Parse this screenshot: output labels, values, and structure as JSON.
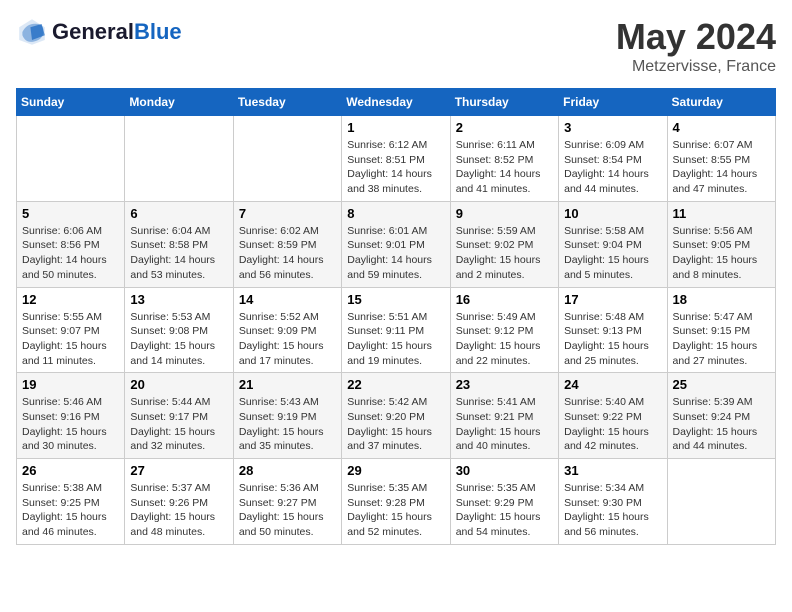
{
  "header": {
    "logo_line1": "General",
    "logo_line2": "Blue",
    "month_title": "May 2024",
    "location": "Metzervisse, France"
  },
  "days_of_week": [
    "Sunday",
    "Monday",
    "Tuesday",
    "Wednesday",
    "Thursday",
    "Friday",
    "Saturday"
  ],
  "weeks": [
    [
      {
        "day": "",
        "info": ""
      },
      {
        "day": "",
        "info": ""
      },
      {
        "day": "",
        "info": ""
      },
      {
        "day": "1",
        "info": "Sunrise: 6:12 AM\nSunset: 8:51 PM\nDaylight: 14 hours and 38 minutes."
      },
      {
        "day": "2",
        "info": "Sunrise: 6:11 AM\nSunset: 8:52 PM\nDaylight: 14 hours and 41 minutes."
      },
      {
        "day": "3",
        "info": "Sunrise: 6:09 AM\nSunset: 8:54 PM\nDaylight: 14 hours and 44 minutes."
      },
      {
        "day": "4",
        "info": "Sunrise: 6:07 AM\nSunset: 8:55 PM\nDaylight: 14 hours and 47 minutes."
      }
    ],
    [
      {
        "day": "5",
        "info": "Sunrise: 6:06 AM\nSunset: 8:56 PM\nDaylight: 14 hours and 50 minutes."
      },
      {
        "day": "6",
        "info": "Sunrise: 6:04 AM\nSunset: 8:58 PM\nDaylight: 14 hours and 53 minutes."
      },
      {
        "day": "7",
        "info": "Sunrise: 6:02 AM\nSunset: 8:59 PM\nDaylight: 14 hours and 56 minutes."
      },
      {
        "day": "8",
        "info": "Sunrise: 6:01 AM\nSunset: 9:01 PM\nDaylight: 14 hours and 59 minutes."
      },
      {
        "day": "9",
        "info": "Sunrise: 5:59 AM\nSunset: 9:02 PM\nDaylight: 15 hours and 2 minutes."
      },
      {
        "day": "10",
        "info": "Sunrise: 5:58 AM\nSunset: 9:04 PM\nDaylight: 15 hours and 5 minutes."
      },
      {
        "day": "11",
        "info": "Sunrise: 5:56 AM\nSunset: 9:05 PM\nDaylight: 15 hours and 8 minutes."
      }
    ],
    [
      {
        "day": "12",
        "info": "Sunrise: 5:55 AM\nSunset: 9:07 PM\nDaylight: 15 hours and 11 minutes."
      },
      {
        "day": "13",
        "info": "Sunrise: 5:53 AM\nSunset: 9:08 PM\nDaylight: 15 hours and 14 minutes."
      },
      {
        "day": "14",
        "info": "Sunrise: 5:52 AM\nSunset: 9:09 PM\nDaylight: 15 hours and 17 minutes."
      },
      {
        "day": "15",
        "info": "Sunrise: 5:51 AM\nSunset: 9:11 PM\nDaylight: 15 hours and 19 minutes."
      },
      {
        "day": "16",
        "info": "Sunrise: 5:49 AM\nSunset: 9:12 PM\nDaylight: 15 hours and 22 minutes."
      },
      {
        "day": "17",
        "info": "Sunrise: 5:48 AM\nSunset: 9:13 PM\nDaylight: 15 hours and 25 minutes."
      },
      {
        "day": "18",
        "info": "Sunrise: 5:47 AM\nSunset: 9:15 PM\nDaylight: 15 hours and 27 minutes."
      }
    ],
    [
      {
        "day": "19",
        "info": "Sunrise: 5:46 AM\nSunset: 9:16 PM\nDaylight: 15 hours and 30 minutes."
      },
      {
        "day": "20",
        "info": "Sunrise: 5:44 AM\nSunset: 9:17 PM\nDaylight: 15 hours and 32 minutes."
      },
      {
        "day": "21",
        "info": "Sunrise: 5:43 AM\nSunset: 9:19 PM\nDaylight: 15 hours and 35 minutes."
      },
      {
        "day": "22",
        "info": "Sunrise: 5:42 AM\nSunset: 9:20 PM\nDaylight: 15 hours and 37 minutes."
      },
      {
        "day": "23",
        "info": "Sunrise: 5:41 AM\nSunset: 9:21 PM\nDaylight: 15 hours and 40 minutes."
      },
      {
        "day": "24",
        "info": "Sunrise: 5:40 AM\nSunset: 9:22 PM\nDaylight: 15 hours and 42 minutes."
      },
      {
        "day": "25",
        "info": "Sunrise: 5:39 AM\nSunset: 9:24 PM\nDaylight: 15 hours and 44 minutes."
      }
    ],
    [
      {
        "day": "26",
        "info": "Sunrise: 5:38 AM\nSunset: 9:25 PM\nDaylight: 15 hours and 46 minutes."
      },
      {
        "day": "27",
        "info": "Sunrise: 5:37 AM\nSunset: 9:26 PM\nDaylight: 15 hours and 48 minutes."
      },
      {
        "day": "28",
        "info": "Sunrise: 5:36 AM\nSunset: 9:27 PM\nDaylight: 15 hours and 50 minutes."
      },
      {
        "day": "29",
        "info": "Sunrise: 5:35 AM\nSunset: 9:28 PM\nDaylight: 15 hours and 52 minutes."
      },
      {
        "day": "30",
        "info": "Sunrise: 5:35 AM\nSunset: 9:29 PM\nDaylight: 15 hours and 54 minutes."
      },
      {
        "day": "31",
        "info": "Sunrise: 5:34 AM\nSunset: 9:30 PM\nDaylight: 15 hours and 56 minutes."
      },
      {
        "day": "",
        "info": ""
      }
    ]
  ]
}
